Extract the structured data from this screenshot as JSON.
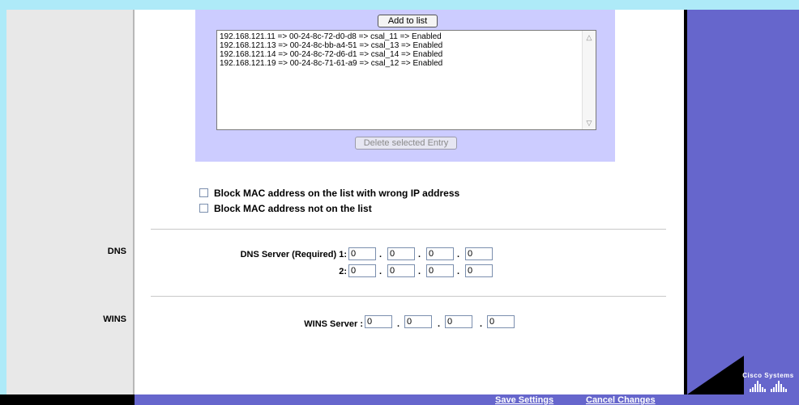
{
  "sections": {
    "dns_label": "DNS",
    "wins_label": "WINS"
  },
  "mac_list": {
    "add_button": "Add to list",
    "entries": [
      "192.168.121.11 => 00-24-8c-72-d0-d8 => csal_11 => Enabled",
      "192.168.121.13 => 00-24-8c-bb-a4-51 => csal_13 => Enabled",
      "192.168.121.14 => 00-24-8c-72-d6-d1 => csal_14 => Enabled",
      "192.168.121.19 => 00-24-8c-71-61-a9 => csal_12 => Enabled"
    ],
    "delete_button": "Delete selected Entry"
  },
  "options": {
    "block_wrong_ip": {
      "label": "Block MAC address on the list with wrong IP address",
      "checked": false
    },
    "block_not_listed": {
      "label": "Block MAC address not on the list",
      "checked": false
    }
  },
  "dns": {
    "server1_label": "DNS Server (Required) 1:",
    "server1": [
      "0",
      "0",
      "0",
      "0"
    ],
    "server2_label": "2:",
    "server2": [
      "0",
      "0",
      "0",
      "0"
    ]
  },
  "wins": {
    "server_label": "WINS Server :",
    "server": [
      "0",
      "0",
      "0",
      "0"
    ]
  },
  "footer": {
    "save_label": "Save Settings",
    "cancel_label": "Cancel Changes"
  },
  "brand": {
    "name": "Cisco Systems"
  },
  "colors": {
    "page_border": "#aeeaf8",
    "side_panel": "#6666cc",
    "list_panel": "#ccccff"
  }
}
